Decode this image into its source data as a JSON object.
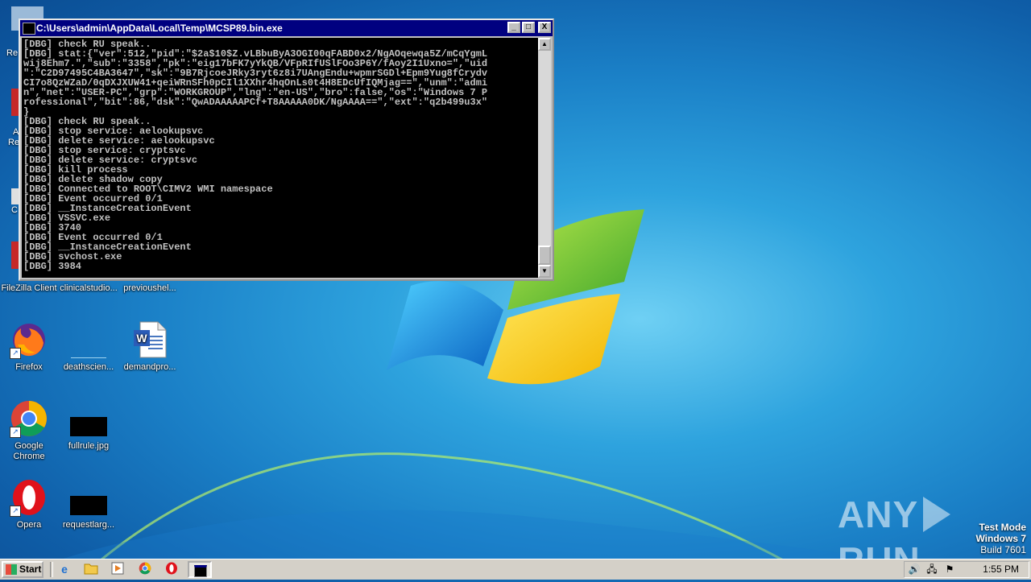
{
  "console": {
    "title": "C:\\Users\\admin\\AppData\\Local\\Temp\\MCSP89.bin.exe",
    "lines": [
      "[DBG] check RU speak..",
      "[DBG] stat:{\"ver\":512,\"pid\":\"$2a$10$Z.vLBbuByA3OGI00qFABD0x2/NgAOqewqa5Z/mCqYgmL",
      "wij8Ehm7.\",\"sub\":\"3358\",\"pk\":\"eig17bFK7yYkQB/VFpRIfUSlFOo3P6Y/fAoy2I1Uxno=\",\"uid",
      "\":\"C2D97495C4BA3647\",\"sk\":\"9B7RjcoeJRky3ryt6z8i7UAngEndu+wpmrSGDl+Epm9Yug8fCrydv",
      "CI7o8QzWZaD/0qDXJXUW41+qeiWRnSFh0pCIl1XXhr4hqOnLs0t4H8EDcUfIQMjag==\",\"unm\":\"admi",
      "n\",\"net\":\"USER-PC\",\"grp\":\"WORKGROUP\",\"lng\":\"en-US\",\"bro\":false,\"os\":\"Windows 7 P",
      "rofessional\",\"bit\":86,\"dsk\":\"QwADAAAAAPCf+T8AAAAA0DK/NgAAAA==\",\"ext\":\"q2b499u3x\"",
      "}",
      "[DBG] check RU speak..",
      "[DBG] stop service: aelookupsvc",
      "[DBG] delete service: aelookupsvc",
      "[DBG] stop service: cryptsvc",
      "[DBG] delete service: cryptsvc",
      "[DBG] kill process",
      "[DBG] delete shadow copy",
      "[DBG] Connected to ROOT\\CIMV2 WMI namespace",
      "[DBG] Event occurred 0/1",
      "[DBG] __InstanceCreationEvent",
      "[DBG] VSSVC.exe",
      "[DBG] 3740",
      "[DBG] Event occurred 0/1",
      "[DBG] __InstanceCreationEvent",
      "[DBG] svchost.exe",
      "[DBG] 3984"
    ],
    "buttons": {
      "minimize": "_",
      "maximize": "□",
      "close": "X"
    }
  },
  "desktop_icons": [
    {
      "label": "FileZilla Client",
      "icon": "filezilla-icon"
    },
    {
      "label": "clinicalstudio...",
      "icon": "file-icon"
    },
    {
      "label": "previoushel...",
      "icon": "file-icon"
    },
    {
      "label": "Firefox",
      "icon": "firefox-icon"
    },
    {
      "label": "deathscien...",
      "icon": "file-icon"
    },
    {
      "label": "demandpro...",
      "icon": "word-doc-icon"
    },
    {
      "label": "Google Chrome",
      "icon": "chrome-icon"
    },
    {
      "label": "fullrule.jpg",
      "icon": "image-file-icon"
    },
    {
      "label": "Opera",
      "icon": "opera-icon"
    },
    {
      "label": "requestlarg...",
      "icon": "image-file-icon"
    }
  ],
  "partial_icon_labels": [
    "Re",
    "A",
    "Re",
    "C"
  ],
  "watermark": {
    "left": "ANY",
    "right": "RUN"
  },
  "test_mode": {
    "line1": "Test Mode",
    "line2": "Windows 7",
    "line3": "Build 7601"
  },
  "taskbar": {
    "start_label": "Start",
    "clock": "1:55 PM"
  }
}
